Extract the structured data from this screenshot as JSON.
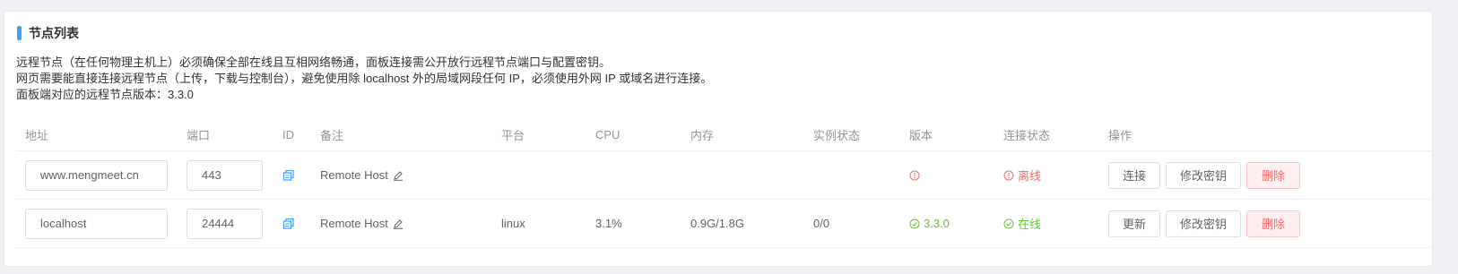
{
  "title": "节点列表",
  "description": [
    "远程节点（在任何物理主机上）必须确保全部在线且互相网络畅通，面板连接需公开放行远程节点端口与配置密钥。",
    "网页需要能直接连接远程节点（上传，下载与控制台），避免使用除 localhost 外的局域网段任何 IP，必须使用外网 IP 或域名进行连接。",
    "面板端对应的远程节点版本：3.3.0"
  ],
  "columns": [
    "地址",
    "端口",
    "ID",
    "备注",
    "平台",
    "CPU",
    "内存",
    "实例状态",
    "版本",
    "连接状态",
    "操作"
  ],
  "rows": [
    {
      "address": "www.mengmeet.cn",
      "port": "443",
      "remark": "Remote Host",
      "platform": "",
      "cpu": "",
      "memory": "",
      "instances": "",
      "version": "",
      "version_state": "error",
      "connection": "离线",
      "connection_state": "offline",
      "actions": [
        "连接",
        "修改密钥",
        "删除"
      ]
    },
    {
      "address": "localhost",
      "port": "24444",
      "remark": "Remote Host",
      "platform": "linux",
      "cpu": "3.1%",
      "memory": "0.9G/1.8G",
      "instances": "0/0",
      "version": "3.3.0",
      "version_state": "ok",
      "connection": "在线",
      "connection_state": "online",
      "actions": [
        "更新",
        "修改密钥",
        "删除"
      ]
    }
  ],
  "colors": {
    "accent": "#409eff",
    "danger": "#f56c6c",
    "success": "#67c23a"
  },
  "icons": [
    "copy-id-icon",
    "edit-pencil-icon",
    "warning-circle-icon",
    "check-circle-icon"
  ]
}
